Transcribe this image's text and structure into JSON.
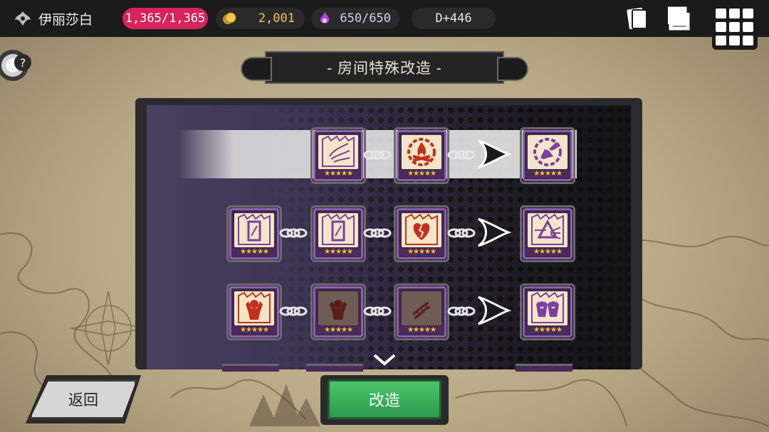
{
  "topbar": {
    "player_name": "伊丽莎白",
    "hp": "1,365/1,365",
    "gold": "2,001",
    "mana": "650/650",
    "day": "D+446"
  },
  "title": "- 房间特殊改造 -",
  "rows": [
    {
      "tiles": [
        {
          "icon": "wind-feather-icon",
          "stars": "★★★★★",
          "dim": false
        },
        {
          "icon": "bonfire-gear-icon",
          "stars": "★★★★★",
          "dim": false
        },
        {
          "icon": "winged-boot-gear-icon",
          "stars": "★★★★★",
          "dim": false
        }
      ]
    },
    {
      "tiles": [
        {
          "icon": "glass-panel-icon",
          "stars": "★★★★★",
          "dim": false
        },
        {
          "icon": "glass-panel-icon",
          "stars": "★★★★★",
          "dim": false
        },
        {
          "icon": "broken-heart-icon",
          "stars": "★★★★★",
          "dim": false
        },
        {
          "icon": "prism-icon",
          "stars": "★★★★★",
          "dim": false
        }
      ]
    },
    {
      "tiles": [
        {
          "icon": "brawler-icon",
          "stars": "★★★★★",
          "dim": false
        },
        {
          "icon": "brawler-icon",
          "stars": "★★★★★",
          "dim": true
        },
        {
          "icon": "dna-icon",
          "stars": "★★★★★",
          "dim": true
        },
        {
          "icon": "twin-brawler-icon",
          "stars": "★★★★★",
          "dim": false
        }
      ]
    }
  ],
  "buttons": {
    "back": "返回",
    "modify": "改造"
  },
  "colors": {
    "hp": "#d6245c",
    "accent_green": "#2e9b4e",
    "tile_border": "#8e5fb0",
    "icon_red": "#c0321e"
  }
}
